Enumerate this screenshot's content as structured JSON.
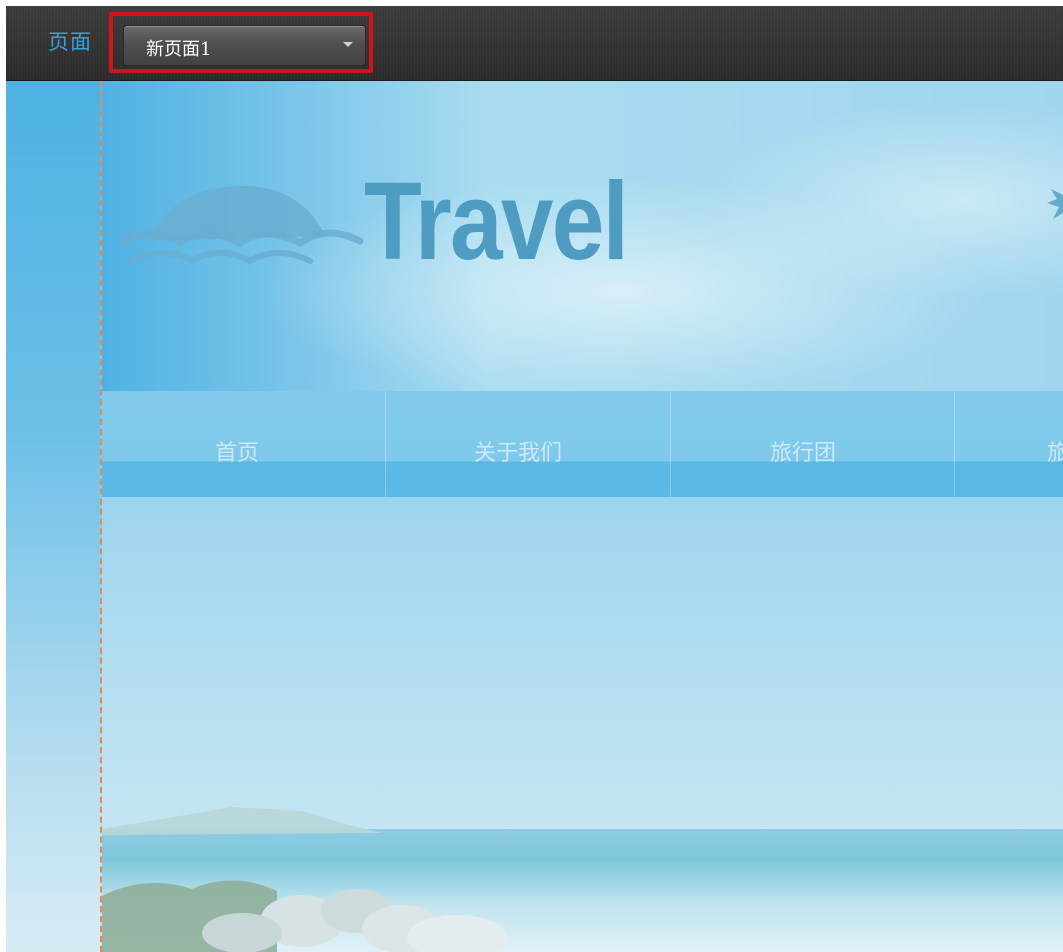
{
  "toolbar": {
    "label": "页面",
    "page_select": {
      "value": "新页面1",
      "highlight_color": "#d3131b",
      "caret_icon": "caret-down-icon"
    },
    "label_color": "#33a3dc"
  },
  "site": {
    "logo_text": "Travel",
    "logo_icon": "sunset-wave-icon",
    "logo_color": "#4f9cc3",
    "nav": [
      {
        "label": "首页"
      },
      {
        "label": "关于我们"
      },
      {
        "label": "旅行团"
      },
      {
        "label": "旅"
      }
    ]
  },
  "guide_color": "#e8894a"
}
